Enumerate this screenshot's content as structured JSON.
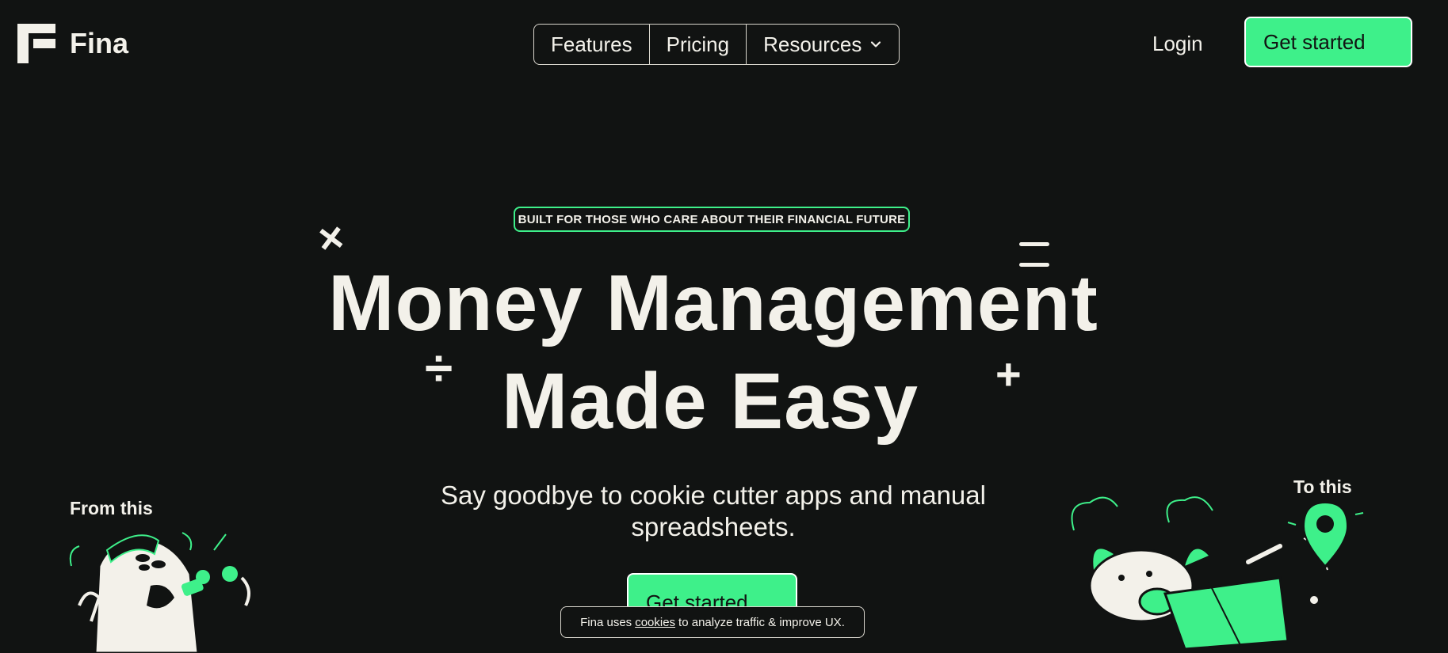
{
  "brand": {
    "name": "Fina",
    "accent": "#3ef08a",
    "background": "#111312",
    "text": "#f3f1ea"
  },
  "nav": {
    "items": [
      "Features",
      "Pricing",
      "Resources"
    ]
  },
  "header": {
    "login_label": "Login",
    "cta_label": "Get started"
  },
  "hero": {
    "badge": "BUILT FOR THOSE WHO CARE ABOUT THEIR FINANCIAL FUTURE",
    "headline_line1": "Money Management",
    "headline_line2": "Made Easy",
    "subheadline": "Say goodbye to cookie cutter apps and manual spreadsheets.",
    "cta_label": "Get started",
    "from_label": "From this",
    "to_label": "To this"
  },
  "cookie_banner": {
    "prefix": "Fina uses",
    "link": "cookies",
    "suffix": "to analyze traffic & improve UX."
  },
  "icons": {
    "logo": "fina-logo-icon",
    "dropdown": "chevron-down-icon"
  }
}
